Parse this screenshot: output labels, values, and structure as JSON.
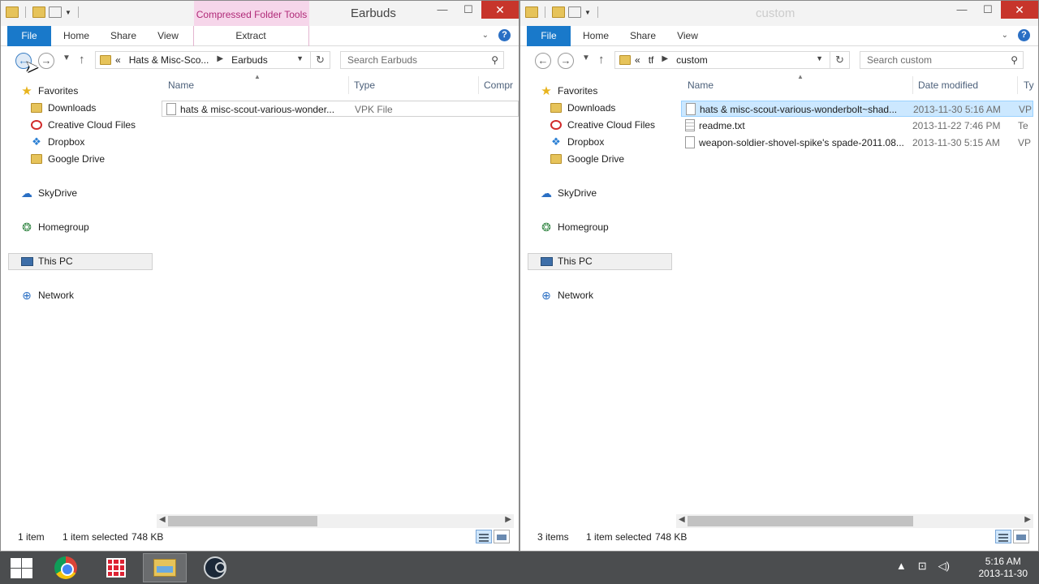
{
  "left_window": {
    "title": "Earbuds",
    "context_tab": "Compressed Folder Tools",
    "ribbon_tabs": [
      "File",
      "Home",
      "Share",
      "View",
      "Extract"
    ],
    "breadcrumb": [
      "Hats & Misc-Sco...",
      "Earbuds"
    ],
    "breadcrumb_prefix": "«",
    "search_placeholder": "Search Earbuds",
    "columns": [
      "Name",
      "Type",
      "Compr"
    ],
    "files": [
      {
        "name": "hats & misc-scout-various-wonder...",
        "type": "VPK File"
      }
    ],
    "status": {
      "count": "1 item",
      "selected": "1 item selected",
      "size": "748 KB"
    }
  },
  "right_window": {
    "title": "custom",
    "ribbon_tabs": [
      "File",
      "Home",
      "Share",
      "View"
    ],
    "breadcrumb": [
      "tf",
      "custom"
    ],
    "breadcrumb_prefix": "«",
    "search_placeholder": "Search custom",
    "columns": [
      "Name",
      "Date modified",
      "Ty"
    ],
    "files": [
      {
        "name": "hats & misc-scout-various-wonderbolt~shad...",
        "date": "2013-11-30 5:16 AM",
        "type": "VP",
        "icon": "file-icon"
      },
      {
        "name": "readme.txt",
        "date": "2013-11-22 7:46 PM",
        "type": "Te",
        "icon": "text-file-icon"
      },
      {
        "name": "weapon-soldier-shovel-spike's spade-2011.08...",
        "date": "2013-11-30 5:15 AM",
        "type": "VP",
        "icon": "file-icon"
      }
    ],
    "status": {
      "count": "3 items",
      "selected": "1 item selected",
      "size": "748 KB"
    }
  },
  "nav_pane": {
    "favorites": "Favorites",
    "favorite_items": [
      "Downloads",
      "Creative Cloud Files",
      "Dropbox",
      "Google Drive"
    ],
    "skydrive": "SkyDrive",
    "homegroup": "Homegroup",
    "thispc": "This PC",
    "network": "Network"
  },
  "taskbar": {
    "time": "5:16 AM",
    "date": "2013-11-30"
  },
  "colors": {
    "file_tab": "#1979ca",
    "context_tab_bg": "#f6d6ea",
    "selection": "#cce8ff",
    "close_button": "#c7352b",
    "taskbar": "#4b4d4f"
  }
}
